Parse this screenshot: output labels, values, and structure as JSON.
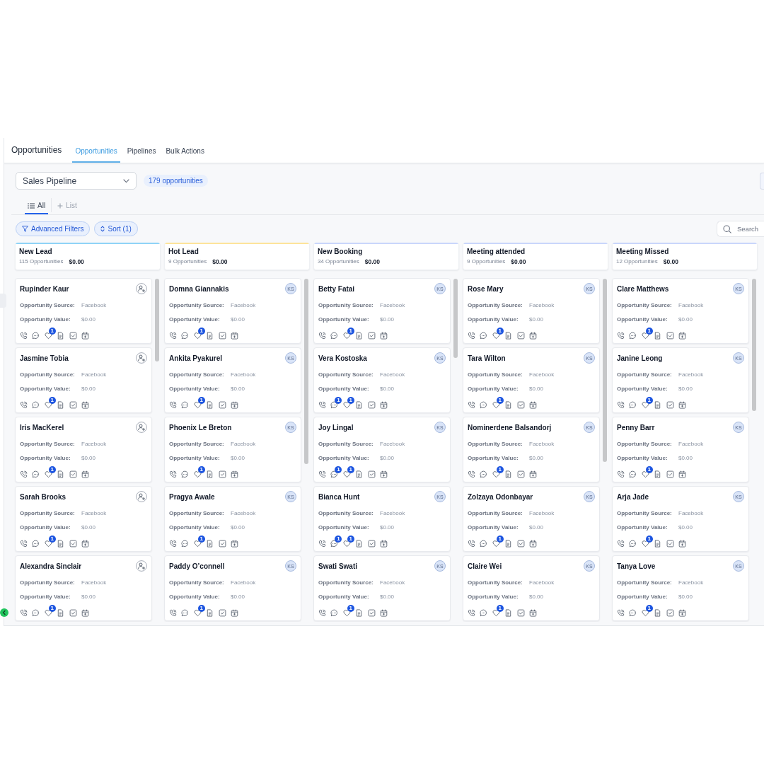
{
  "header": {
    "title": "Opportunities",
    "tabs": [
      {
        "label": "Opportunities",
        "selected": true
      },
      {
        "label": "Pipelines",
        "selected": false
      },
      {
        "label": "Bulk Actions",
        "selected": false
      }
    ]
  },
  "toolbar": {
    "pipeline": "Sales Pipeline",
    "count": "179 opportunities"
  },
  "views": [
    {
      "label": "All",
      "kind": "list",
      "selected": true
    },
    {
      "label": "List",
      "kind": "add",
      "selected": false
    }
  ],
  "filters": [
    {
      "label": "Advanced Filters",
      "kind": "filter"
    },
    {
      "label": "Sort (1)",
      "kind": "sort"
    }
  ],
  "search": {
    "placeholder": "Search"
  },
  "columns": [
    {
      "title": "New Lead",
      "count": "115 Opportunities",
      "total": "$0.00",
      "color": "#8fd3f7",
      "cards": [
        {
          "name": "Rupinder Kaur",
          "source_label": "Opportunity Source:",
          "source": "Facebook",
          "value_label": "Opportunity Value:",
          "value": "$0.00",
          "tag_badge": "1"
        },
        {
          "name": "Jasmine Tobia",
          "source_label": "Opportunity Source:",
          "source": "Facebook",
          "value_label": "Opportunity Value:",
          "value": "$0.00",
          "tag_badge": "1"
        },
        {
          "name": "Iris MacKerel",
          "source_label": "Opportunity Source:",
          "source": "Facebook",
          "value_label": "Opportunity Value:",
          "value": "$0.00",
          "tag_badge": "1"
        },
        {
          "name": "Sarah Brooks",
          "source_label": "Opportunity Source:",
          "source": "Facebook",
          "value_label": "Opportunity Value:",
          "value": "$0.00",
          "tag_badge": "1"
        },
        {
          "name": "Alexandra Sinclair",
          "source_label": "Opportunity Source:",
          "source": "Facebook",
          "value_label": "Opportunity Value:",
          "value": "$0.00",
          "tag_badge": "1"
        }
      ]
    },
    {
      "title": "Hot Lead",
      "count": "9 Opportunities",
      "total": "$0.00",
      "color": "#fde49a",
      "cards": [
        {
          "name": "Domna Giannakis",
          "assignee": "KS",
          "source_label": "Opportunity Source:",
          "source": "Facebook",
          "value_label": "Opportunity Value:",
          "value": "$0.00",
          "tag_badge": "1"
        },
        {
          "name": "Ankita Pyakurel",
          "assignee": "KS",
          "source_label": "Opportunity Source:",
          "source": "Facebook",
          "value_label": "Opportunity Value:",
          "value": "$0.00",
          "tag_badge": "1"
        },
        {
          "name": "Phoenix Le Breton",
          "assignee": "KS",
          "source_label": "Opportunity Source:",
          "source": "Facebook",
          "value_label": "Opportunity Value:",
          "value": "$0.00",
          "tag_badge": "1"
        },
        {
          "name": "Pragya Awale",
          "assignee": "KS",
          "source_label": "Opportunity Source:",
          "source": "Facebook",
          "value_label": "Opportunity Value:",
          "value": "$0.00",
          "tag_badge": "1"
        },
        {
          "name": "Paddy O’connell",
          "assignee": "KS",
          "source_label": "Opportunity Source:",
          "source": "Facebook",
          "value_label": "Opportunity Value:",
          "value": "$0.00",
          "tag_badge": "1"
        }
      ]
    },
    {
      "title": "New Booking",
      "count": "34 Opportunities",
      "total": "$0.00",
      "color": "#c9d6fb",
      "cards": [
        {
          "name": "Betty Fatai",
          "assignee": "KS",
          "source_label": "Opportunity Source:",
          "source": "Facebook",
          "value_label": "Opportunity Value:",
          "value": "$0.00",
          "tag_badge": "1"
        },
        {
          "name": "Vera Kostoska",
          "assignee": "KS",
          "source_label": "Opportunity Source:",
          "source": "Facebook",
          "value_label": "Opportunity Value:",
          "value": "$0.00",
          "chat_badge": "1",
          "tag_badge": "1"
        },
        {
          "name": "Joy Lingal",
          "assignee": "KS",
          "source_label": "Opportunity Source:",
          "source": "Facebook",
          "value_label": "Opportunity Value:",
          "value": "$0.00",
          "chat_badge": "1",
          "tag_badge": "1"
        },
        {
          "name": "Bianca Hunt",
          "assignee": "KS",
          "source_label": "Opportunity Source:",
          "source": "Facebook",
          "value_label": "Opportunity Value:",
          "value": "$0.00",
          "chat_badge": "1",
          "tag_badge": "1"
        },
        {
          "name": "Swati Swati",
          "assignee": "KS",
          "source_label": "Opportunity Source:",
          "source": "Facebook",
          "value_label": "Opportunity Value:",
          "value": "$0.00",
          "tag_badge": "1"
        }
      ]
    },
    {
      "title": "Meeting attended",
      "count": "9 Opportunities",
      "total": "$0.00",
      "color": "#c9d6fb",
      "cards": [
        {
          "name": "Rose Mary",
          "assignee": "KS",
          "source_label": "Opportunity Source:",
          "source": "Facebook",
          "value_label": "Opportunity Value:",
          "value": "$0.00",
          "tag_badge": "1"
        },
        {
          "name": "Tara Wilton",
          "assignee": "KS",
          "source_label": "Opportunity Source:",
          "source": "Facebook",
          "value_label": "Opportunity Value:",
          "value": "$0.00",
          "tag_badge": "1"
        },
        {
          "name": "Nominerdene Balsandorj",
          "assignee": "KS",
          "source_label": "Opportunity Source:",
          "source": "Facebook",
          "value_label": "Opportunity Value:",
          "value": "$0.00",
          "tag_badge": "1"
        },
        {
          "name": "Zolzaya Odonbayar",
          "assignee": "KS",
          "source_label": "Opportunity Source:",
          "source": "Facebook",
          "value_label": "Opportunity Value:",
          "value": "$0.00",
          "tag_badge": "1"
        },
        {
          "name": "Claire Wei",
          "assignee": "KS",
          "source_label": "Opportunity Source:",
          "source": "Facebook",
          "value_label": "Opportunity Value:",
          "value": "$0.00",
          "tag_badge": "1"
        }
      ]
    },
    {
      "title": "Meeting Missed",
      "count": "12 Opportunities",
      "total": "$0.00",
      "color": "#c9d6fb",
      "cards": [
        {
          "name": "Clare Matthews",
          "assignee": "KS",
          "source_label": "Opportunity Source:",
          "source": "Facebook",
          "value_label": "Opportunity Value:",
          "value": "$0.00",
          "tag_badge": "1"
        },
        {
          "name": "Janine Leong",
          "assignee": "KS",
          "source_label": "Opportunity Source:",
          "source": "Facebook",
          "value_label": "Opportunity Value:",
          "value": "$0.00",
          "tag_badge": "1"
        },
        {
          "name": "Penny Barr",
          "assignee": "KS",
          "source_label": "Opportunity Source:",
          "source": "Facebook",
          "value_label": "Opportunity Value:",
          "value": "$0.00",
          "tag_badge": "1"
        },
        {
          "name": "Arja Jade",
          "assignee": "KS",
          "source_label": "Opportunity Source:",
          "source": "Facebook",
          "value_label": "Opportunity Value:",
          "value": "$0.00",
          "tag_badge": "1"
        },
        {
          "name": "Tanya Love",
          "assignee": "KS",
          "source_label": "Opportunity Source:",
          "source": "Facebook",
          "value_label": "Opportunity Value:",
          "value": "$0.00",
          "tag_badge": "1"
        }
      ]
    }
  ]
}
